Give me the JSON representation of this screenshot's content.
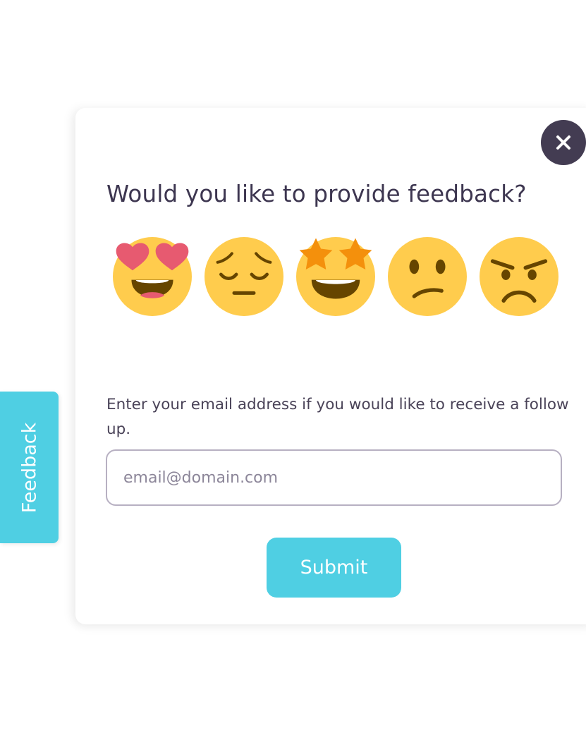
{
  "dialog": {
    "question": "Would you like to provide feedback?",
    "email_prompt": "Enter your email address if you would like to receive a follow up.",
    "email_placeholder": "email@domain.com",
    "email_value": "",
    "submit_label": "Submit",
    "close_icon": "close-icon"
  },
  "ratings": [
    {
      "name": "heart-eyes-emoji-icon"
    },
    {
      "name": "pensive-emoji-icon"
    },
    {
      "name": "star-struck-emoji-icon"
    },
    {
      "name": "confused-emoji-icon"
    },
    {
      "name": "angry-emoji-icon"
    }
  ],
  "side_tab": {
    "label": "Feedback"
  },
  "colors": {
    "accent": "#4fcfe3",
    "close_button": "#433c52",
    "heading_text": "#3d3650",
    "emoji_face": "#ffcc4d",
    "emoji_features": "#664500",
    "heart": "#e75a70",
    "star": "#f4900c",
    "input_border": "#b7b0c2"
  }
}
